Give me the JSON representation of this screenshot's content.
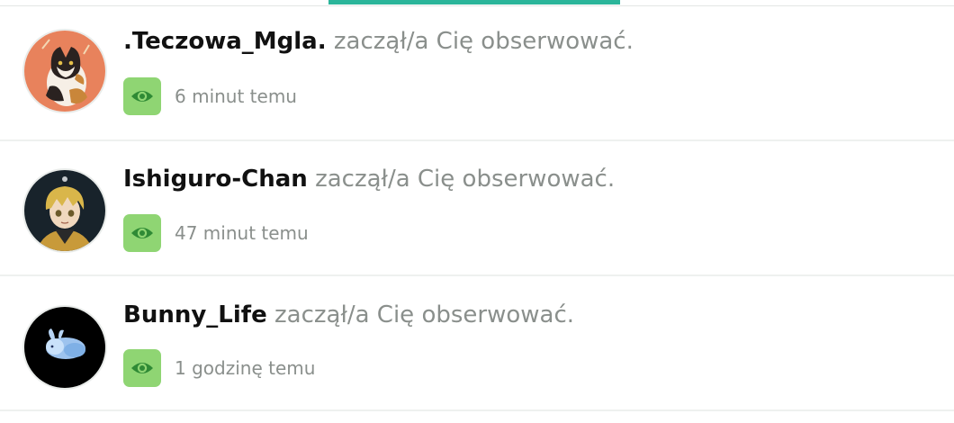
{
  "tabs": {
    "active_indicator_color": "#2bb59a"
  },
  "notifications": [
    {
      "username": ".Teczowa_Mgla.",
      "action": "zaczął/a Cię obserwować.",
      "time": "6 minut temu",
      "avatar_icon": "cat-avatar-icon",
      "status_icon": "eye-icon"
    },
    {
      "username": "Ishiguro-Chan",
      "action": "zaczął/a Cię obserwować.",
      "time": "47 minut temu",
      "avatar_icon": "anime-character-avatar-icon",
      "status_icon": "eye-icon"
    },
    {
      "username": "Bunny_Life",
      "action": "zaczął/a Cię obserwować.",
      "time": "1 godzinę temu",
      "avatar_icon": "bunny-avatar-icon",
      "status_icon": "eye-icon"
    }
  ],
  "colors": {
    "seen_badge": "#8fd573",
    "eye": "#2f8a35"
  }
}
